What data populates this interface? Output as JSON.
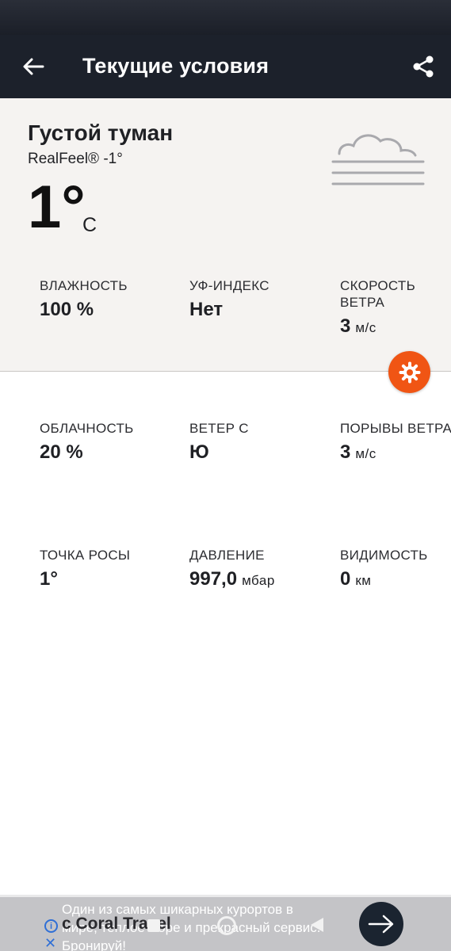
{
  "header": {
    "title": "Текущие условия"
  },
  "current": {
    "condition": "Густой туман",
    "realfeel": "RealFeel® -1°",
    "temperature": "1°",
    "unit": "C",
    "icon": "fog-icon"
  },
  "metrics_top": [
    {
      "label": "Влажность",
      "value": "100 %",
      "unit": ""
    },
    {
      "label": "УФ-индекс",
      "value": "Нет",
      "unit": ""
    },
    {
      "label": "Скорость ветра",
      "value": "3",
      "unit": "м/с"
    }
  ],
  "metrics_mid": [
    {
      "label": "Облачность",
      "value": "20 %",
      "unit": ""
    },
    {
      "label": "Ветер с",
      "value": "Ю",
      "unit": ""
    },
    {
      "label": "Порывы ветра",
      "value": "3",
      "unit": "м/с"
    }
  ],
  "metrics_bottom": [
    {
      "label": "Точка росы",
      "value": "1°",
      "unit": ""
    },
    {
      "label": "Давление",
      "value": "997,0",
      "unit": "мбар"
    },
    {
      "label": "Видимость",
      "value": "0",
      "unit": "км"
    }
  ],
  "ad": {
    "text": "Один из самых шикарных курортов в мире, теплое море и прекрасный сервис. Бронируй!",
    "brand": "с Coral Travel",
    "info_icon": "i",
    "close_icon": "✕"
  },
  "colors": {
    "app_bar": "#1c212b",
    "accent": "#f05514",
    "hero_bg": "#f5f3f1"
  }
}
